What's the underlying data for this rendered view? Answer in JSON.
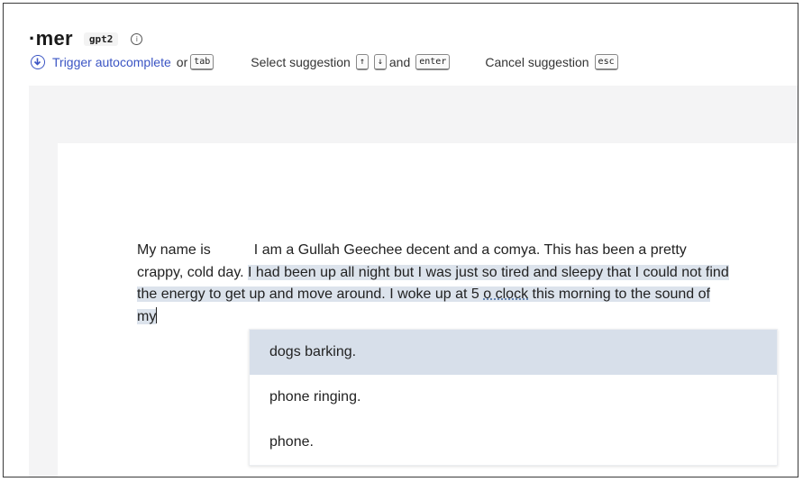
{
  "header": {
    "app_title": "·mer",
    "model": "gpt2",
    "info_icon": "i"
  },
  "shortcuts": {
    "trigger_label": "Trigger autocomplete",
    "or": "or",
    "tab_key": "tab",
    "select_label": "Select suggestion",
    "up_key": "↑",
    "down_key": "↓",
    "and": "and",
    "enter_key": "enter",
    "cancel_label": "Cancel suggestion",
    "esc_key": "esc"
  },
  "editor": {
    "part1": "My name is",
    "part2": "I am a Gullah Geechee decent and a comya. This has been a pretty crappy, cold day.",
    "part3_a": "I had been up all night but I was just so tired and sleepy that I could not find the energy to get up and move around. I woke up at 5 ",
    "part3_err": "o clock",
    "part3_b": " this morning to the sound of my"
  },
  "suggestions": [
    {
      "label": "dogs barking."
    },
    {
      "label": "phone ringing."
    },
    {
      "label": "phone."
    }
  ],
  "colors": {
    "accent": "#3b55c4",
    "highlight": "#dce3ec",
    "active_suggestion": "#d7dfea"
  }
}
